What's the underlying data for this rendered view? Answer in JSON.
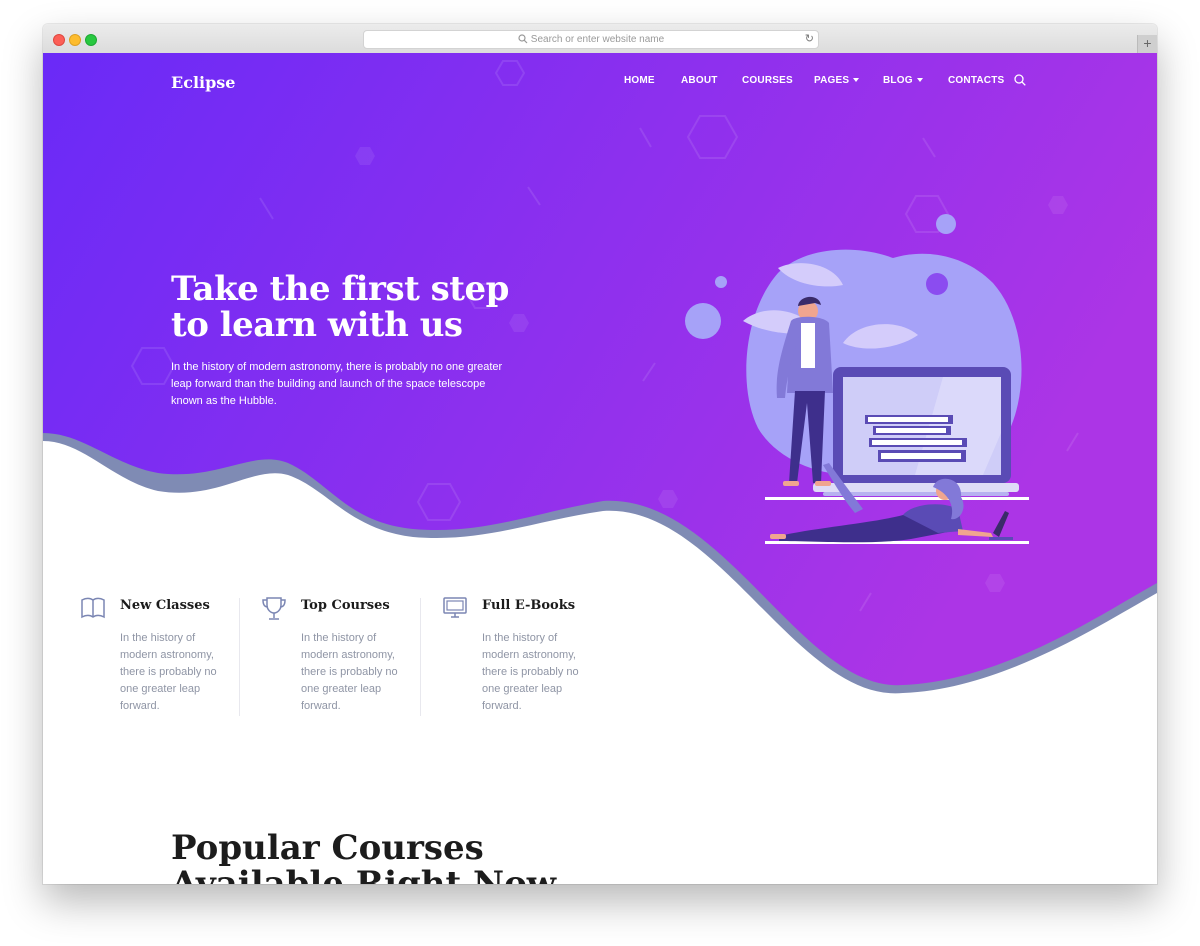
{
  "browser": {
    "url_placeholder": "Search or enter website name"
  },
  "brand": {
    "name": "Eclipse"
  },
  "nav": {
    "items": [
      {
        "label": "HOME",
        "dropdown": false
      },
      {
        "label": "ABOUT",
        "dropdown": false
      },
      {
        "label": "COURSES",
        "dropdown": false
      },
      {
        "label": "PAGES",
        "dropdown": true
      },
      {
        "label": "BLOG",
        "dropdown": true
      },
      {
        "label": "CONTACTS",
        "dropdown": false
      }
    ],
    "search_icon": "search-icon"
  },
  "hero": {
    "title_line1": "Take the first step",
    "title_line2": "to learn with us",
    "text": "In the history of modern astronomy, there is probably no one greater leap forward than the building and launch of the space telescope known as the Hubble."
  },
  "features": [
    {
      "icon": "book-icon",
      "title": "New Classes",
      "text": "In the history of modern astronomy, there is probably no one greater leap forward."
    },
    {
      "icon": "trophy-icon",
      "title": "Top Courses",
      "text": "In the history of modern astronomy, there is probably no one greater leap forward."
    },
    {
      "icon": "monitor-icon",
      "title": "Full E-Books",
      "text": "In the history of modern astronomy, there is probably no one greater leap forward."
    }
  ],
  "popular": {
    "title_line1": "Popular Courses",
    "title_line2": "Available Right Now"
  },
  "colors": {
    "gradient_start": "#6a2af7",
    "gradient_end": "#a835e8",
    "wave_edge": "#7f8bb4",
    "illustration_blob": "#a6a2f8",
    "text_muted": "#8f95a5"
  }
}
